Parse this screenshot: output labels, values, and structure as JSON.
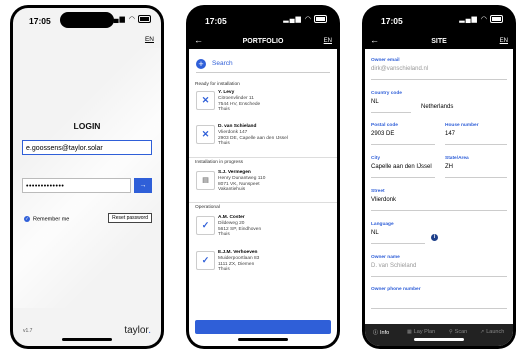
{
  "login_screen": {
    "time": "17:05",
    "language": "EN",
    "title": "LOGIN",
    "email_value": "e.goossens@taylor.solar",
    "password_value": "•••••••••••••",
    "go_arrow": "→",
    "remember_label": "Remember me",
    "reset_label": "Reset password",
    "version": "v1.7",
    "brand": "taylor",
    "brand_dot": "."
  },
  "portfolio_screen": {
    "time": "17:05",
    "back": "←",
    "title": "PORTFOLIO",
    "language": "EN",
    "search_placeholder": "Search",
    "sections": [
      {
        "label": "Ready for installation"
      },
      {
        "label": "Installation in progress"
      },
      {
        "label": "Operational"
      }
    ],
    "items": [
      {
        "name": "Y. Levy",
        "street": "Citroenvlinder 11",
        "city": "7544 HV, Enschede",
        "note": "Thuis",
        "icon": "tools-icon"
      },
      {
        "name": "D. van Schieland",
        "street": "Vlierdonk 147",
        "city": "2903 DE, Capelle aan den IJssel",
        "note": "Thuis",
        "icon": "tools-icon"
      },
      {
        "name": "S.J. Vermegen",
        "street": "Henry Dunantweg 110",
        "city": "8071 VK, Nunspeet",
        "note": "Vakantiehuis",
        "icon": "installation-icon"
      },
      {
        "name": "A.M. Coster",
        "street": "Dildeweg 20",
        "city": "5612 SP, Eindhoven",
        "note": "Thuis",
        "icon": "check-icon"
      },
      {
        "name": "E.J.M. Verhoeven",
        "street": "Muiderpoortlaan 83",
        "city": "1111 ZX, Diemen",
        "note": "Thuis",
        "icon": "check-icon"
      }
    ]
  },
  "site_screen": {
    "time": "17:05",
    "back": "←",
    "title": "SITE",
    "language": "EN",
    "owner_email_label": "Owner email",
    "owner_email_value": "dirk@vanschieland.nl",
    "country_code_label": "Country code",
    "country_code_value": "NL",
    "country_name": "Netherlands",
    "postal_code_label": "Postal code",
    "postal_code_value": "2903 DE",
    "house_number_label": "House number",
    "house_number_value": "147",
    "city_label": "City",
    "city_value": "Capelle aan den IJssel",
    "state_label": "State/Area",
    "state_value": "ZH",
    "street_label": "Street",
    "street_value": "Vlierdonk",
    "language_label": "Language",
    "language_value": "NL",
    "owner_name_label": "Owner name",
    "owner_name_value": "D. van Schieland",
    "owner_phone_label": "Owner phone number",
    "tabs": [
      {
        "label": "Info",
        "icon": "info-icon"
      },
      {
        "label": "Lay Plan",
        "icon": "grid-icon"
      },
      {
        "label": "Scan",
        "icon": "scan-icon"
      },
      {
        "label": "Launch",
        "icon": "launch-icon"
      }
    ]
  }
}
